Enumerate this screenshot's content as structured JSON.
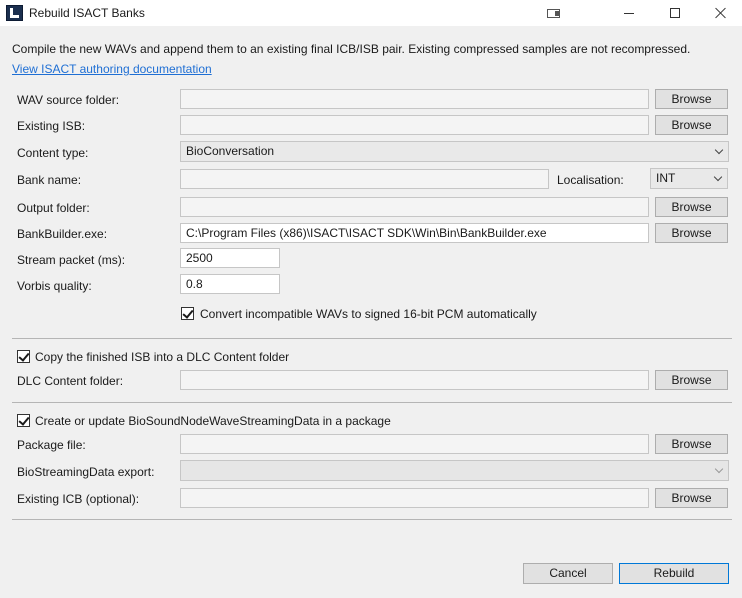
{
  "window": {
    "title": "Rebuild ISACT Banks"
  },
  "intro_text": "Compile the new WAVs and append them to an existing final ICB/ISB pair. Existing compressed samples are not recompressed.",
  "doc_link": "View ISACT authoring documentation",
  "fields": {
    "wav_source": {
      "label": "WAV source folder:",
      "value": ""
    },
    "existing_isb": {
      "label": "Existing ISB:",
      "value": ""
    },
    "content_type": {
      "label": "Content type:",
      "value": "BioConversation"
    },
    "bank_name": {
      "label": "Bank name:",
      "value": ""
    },
    "localisation": {
      "label": "Localisation:",
      "value": "INT"
    },
    "output_folder": {
      "label": "Output folder:",
      "value": ""
    },
    "bankbuilder": {
      "label": "BankBuilder.exe:",
      "value": "C:\\Program Files (x86)\\ISACT\\ISACT SDK\\Win\\Bin\\BankBuilder.exe"
    },
    "stream_packet": {
      "label": "Stream packet (ms):",
      "value": "2500"
    },
    "vorbis_quality": {
      "label": "Vorbis quality:",
      "value": "0.8"
    }
  },
  "convert_checkbox": {
    "label": "Convert incompatible WAVs to signed 16-bit PCM automatically",
    "checked": true
  },
  "dlc": {
    "checkbox_label": "Copy the finished ISB into a DLC Content folder",
    "checked": true,
    "folder_label": "DLC Content folder:",
    "folder_value": ""
  },
  "package": {
    "checkbox_label": "Create or update BioSoundNodeWaveStreamingData in a package",
    "checked": true,
    "package_file_label": "Package file:",
    "package_file_value": "",
    "export_label": "BioStreamingData export:",
    "export_value": "",
    "icb_label": "Existing ICB (optional):",
    "icb_value": ""
  },
  "buttons": {
    "browse": "Browse",
    "cancel": "Cancel",
    "rebuild": "Rebuild"
  }
}
